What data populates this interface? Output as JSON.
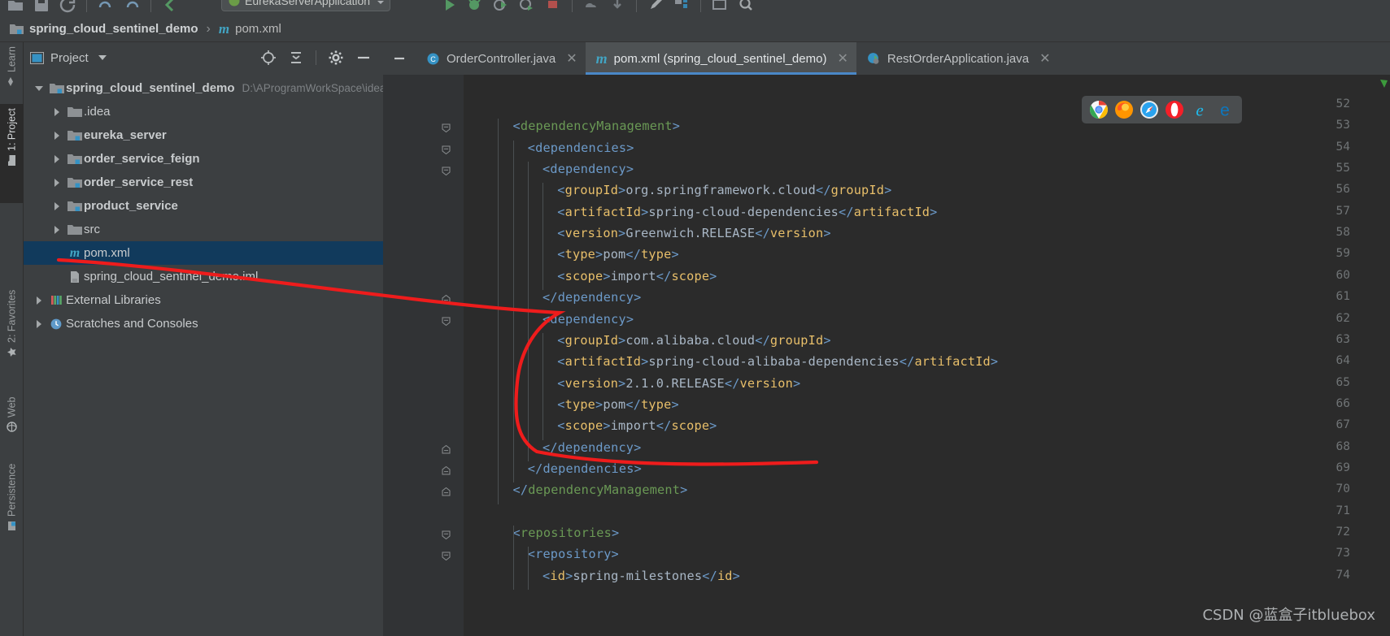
{
  "toolbar": {
    "run_config_label": "EurekaServerApplication",
    "icons": [
      "open-folder-icon",
      "save-icon",
      "sync-icon",
      "undo-icon",
      "redo-icon",
      "back-icon",
      "forward-icon",
      "run-icon",
      "debug-icon",
      "run-coverage-icon",
      "stop-icon",
      "build-icon",
      "update-project-icon",
      "commit-icon",
      "structure-icon",
      "preview-icon",
      "search-icon"
    ]
  },
  "breadcrumb": {
    "project": "spring_cloud_sentinel_demo",
    "separator": "›",
    "file": "pom.xml",
    "file_icon_letter": "m"
  },
  "leftbar": {
    "items": [
      {
        "label": "Learn",
        "icon": "learn-icon",
        "active": false
      },
      {
        "label": "1: Project",
        "icon": "project-folder-icon",
        "active": true
      },
      {
        "label": "2: Favorites",
        "icon": "star-icon",
        "active": false
      },
      {
        "label": "Web",
        "icon": "globe-icon",
        "active": false
      },
      {
        "label": "Persistence",
        "icon": "persistence-icon",
        "active": false
      }
    ]
  },
  "project_panel": {
    "title": "Project",
    "title_icon": "project-view-icon",
    "actions": [
      "locate-icon",
      "collapse-all-icon",
      "settings-gear-icon",
      "hide-minus-icon"
    ],
    "tree": [
      {
        "label": "spring_cloud_sentinel_demo",
        "path": "D:\\AProgramWorkSpace\\idea\\test\\spring_cloud_sentinel_demo",
        "indent": 0,
        "arrow": "open",
        "icon": "module-folder-icon",
        "bold": true,
        "selected": false
      },
      {
        "label": ".idea",
        "path": "",
        "indent": 1,
        "arrow": "closed",
        "icon": "folder-icon",
        "bold": false,
        "selected": false
      },
      {
        "label": "eureka_server",
        "path": "",
        "indent": 1,
        "arrow": "closed",
        "icon": "module-folder-icon",
        "bold": true,
        "selected": false
      },
      {
        "label": "order_service_feign",
        "path": "",
        "indent": 1,
        "arrow": "closed",
        "icon": "module-folder-icon",
        "bold": true,
        "selected": false
      },
      {
        "label": "order_service_rest",
        "path": "",
        "indent": 1,
        "arrow": "closed",
        "icon": "module-folder-icon",
        "bold": true,
        "selected": false
      },
      {
        "label": "product_service",
        "path": "",
        "indent": 1,
        "arrow": "closed",
        "icon": "module-folder-icon",
        "bold": true,
        "selected": false
      },
      {
        "label": "src",
        "path": "",
        "indent": 1,
        "arrow": "closed",
        "icon": "folder-icon",
        "bold": false,
        "selected": false
      },
      {
        "label": "pom.xml",
        "path": "",
        "indent": 1,
        "arrow": "none",
        "icon": "maven-pom-icon",
        "bold": false,
        "selected": true
      },
      {
        "label": "spring_cloud_sentinel_demo.iml",
        "path": "",
        "indent": 1,
        "arrow": "none",
        "icon": "iml-file-icon",
        "bold": false,
        "selected": false
      },
      {
        "label": "External Libraries",
        "path": "",
        "indent": 0,
        "arrow": "closed",
        "icon": "libraries-icon",
        "bold": false,
        "selected": false
      },
      {
        "label": "Scratches and Consoles",
        "path": "",
        "indent": 0,
        "arrow": "closed",
        "icon": "scratches-icon",
        "bold": false,
        "selected": false
      }
    ]
  },
  "editor_tabs": {
    "hide_label": "—",
    "tabs": [
      {
        "label": "OrderController.java",
        "icon": "java-class-icon",
        "active": false,
        "close": "✕"
      },
      {
        "label": "pom.xml (spring_cloud_sentinel_demo)",
        "icon": "maven-pom-icon",
        "active": true,
        "close": "✕"
      },
      {
        "label": "RestOrderApplication.java",
        "icon": "spring-boot-class-icon",
        "active": false,
        "close": "✕"
      }
    ]
  },
  "editor": {
    "first_line": 52,
    "lines": [
      {
        "n": 52,
        "fold": "none",
        "indent": 0,
        "tokens": []
      },
      {
        "n": 53,
        "fold": "open",
        "indent": 2,
        "tokens": [
          {
            "t": "br",
            "v": "<"
          },
          {
            "t": "gtag",
            "v": "dependencyManagement"
          },
          {
            "t": "br",
            "v": ">"
          }
        ]
      },
      {
        "n": 54,
        "fold": "open",
        "indent": 3,
        "tokens": [
          {
            "t": "br",
            "v": "<"
          },
          {
            "t": "br2",
            "v": "dependencies"
          },
          {
            "t": "br",
            "v": ">"
          }
        ]
      },
      {
        "n": 55,
        "fold": "open",
        "indent": 4,
        "tokens": [
          {
            "t": "br",
            "v": "<"
          },
          {
            "t": "br2",
            "v": "dependency"
          },
          {
            "t": "br",
            "v": ">"
          }
        ]
      },
      {
        "n": 56,
        "fold": "none",
        "indent": 5,
        "tokens": [
          {
            "t": "br",
            "v": "<"
          },
          {
            "t": "tg",
            "v": "groupId"
          },
          {
            "t": "br",
            "v": ">"
          },
          {
            "t": "txt",
            "v": "org.springframework.cloud"
          },
          {
            "t": "br",
            "v": "</"
          },
          {
            "t": "tg",
            "v": "groupId"
          },
          {
            "t": "br",
            "v": ">"
          }
        ]
      },
      {
        "n": 57,
        "fold": "none",
        "indent": 5,
        "tokens": [
          {
            "t": "br",
            "v": "<"
          },
          {
            "t": "tg",
            "v": "artifactId"
          },
          {
            "t": "br",
            "v": ">"
          },
          {
            "t": "txt",
            "v": "spring-cloud-dependencies"
          },
          {
            "t": "br",
            "v": "</"
          },
          {
            "t": "tg",
            "v": "artifactId"
          },
          {
            "t": "br",
            "v": ">"
          }
        ]
      },
      {
        "n": 58,
        "fold": "none",
        "indent": 5,
        "tokens": [
          {
            "t": "br",
            "v": "<"
          },
          {
            "t": "tg",
            "v": "version"
          },
          {
            "t": "br",
            "v": ">"
          },
          {
            "t": "txt",
            "v": "Greenwich.RELEASE"
          },
          {
            "t": "br",
            "v": "</"
          },
          {
            "t": "tg",
            "v": "version"
          },
          {
            "t": "br",
            "v": ">"
          }
        ]
      },
      {
        "n": 59,
        "fold": "none",
        "indent": 5,
        "tokens": [
          {
            "t": "br",
            "v": "<"
          },
          {
            "t": "tg",
            "v": "type"
          },
          {
            "t": "br",
            "v": ">"
          },
          {
            "t": "txt",
            "v": "pom"
          },
          {
            "t": "br",
            "v": "</"
          },
          {
            "t": "tg",
            "v": "type"
          },
          {
            "t": "br",
            "v": ">"
          }
        ]
      },
      {
        "n": 60,
        "fold": "none",
        "indent": 5,
        "tokens": [
          {
            "t": "br",
            "v": "<"
          },
          {
            "t": "tg",
            "v": "scope"
          },
          {
            "t": "br",
            "v": ">"
          },
          {
            "t": "txt",
            "v": "import"
          },
          {
            "t": "br",
            "v": "</"
          },
          {
            "t": "tg",
            "v": "scope"
          },
          {
            "t": "br",
            "v": ">"
          }
        ]
      },
      {
        "n": 61,
        "fold": "close",
        "indent": 4,
        "tokens": [
          {
            "t": "br",
            "v": "</"
          },
          {
            "t": "br2",
            "v": "dependency"
          },
          {
            "t": "br",
            "v": ">"
          }
        ]
      },
      {
        "n": 62,
        "fold": "open",
        "indent": 4,
        "tokens": [
          {
            "t": "br",
            "v": "<"
          },
          {
            "t": "br2",
            "v": "dependency"
          },
          {
            "t": "br",
            "v": ">"
          }
        ]
      },
      {
        "n": 63,
        "fold": "none",
        "indent": 5,
        "tokens": [
          {
            "t": "br",
            "v": "<"
          },
          {
            "t": "tg",
            "v": "groupId"
          },
          {
            "t": "br",
            "v": ">"
          },
          {
            "t": "txt",
            "v": "com.alibaba.cloud"
          },
          {
            "t": "br",
            "v": "</"
          },
          {
            "t": "tg",
            "v": "groupId"
          },
          {
            "t": "br",
            "v": ">"
          }
        ]
      },
      {
        "n": 64,
        "fold": "none",
        "indent": 5,
        "tokens": [
          {
            "t": "br",
            "v": "<"
          },
          {
            "t": "tg",
            "v": "artifactId"
          },
          {
            "t": "br",
            "v": ">"
          },
          {
            "t": "txt",
            "v": "spring-cloud-alibaba-dependencies"
          },
          {
            "t": "br",
            "v": "</"
          },
          {
            "t": "tg",
            "v": "artifactId"
          },
          {
            "t": "br",
            "v": ">"
          }
        ]
      },
      {
        "n": 65,
        "fold": "none",
        "indent": 5,
        "tokens": [
          {
            "t": "br",
            "v": "<"
          },
          {
            "t": "tg",
            "v": "version"
          },
          {
            "t": "br",
            "v": ">"
          },
          {
            "t": "txt",
            "v": "2.1.0.RELEASE"
          },
          {
            "t": "br",
            "v": "</"
          },
          {
            "t": "tg",
            "v": "version"
          },
          {
            "t": "br",
            "v": ">"
          }
        ]
      },
      {
        "n": 66,
        "fold": "none",
        "indent": 5,
        "tokens": [
          {
            "t": "br",
            "v": "<"
          },
          {
            "t": "tg",
            "v": "type"
          },
          {
            "t": "br",
            "v": ">"
          },
          {
            "t": "txt",
            "v": "pom"
          },
          {
            "t": "br",
            "v": "</"
          },
          {
            "t": "tg",
            "v": "type"
          },
          {
            "t": "br",
            "v": ">"
          }
        ]
      },
      {
        "n": 67,
        "fold": "none",
        "indent": 5,
        "tokens": [
          {
            "t": "br",
            "v": "<"
          },
          {
            "t": "tg",
            "v": "scope"
          },
          {
            "t": "br",
            "v": ">"
          },
          {
            "t": "txt",
            "v": "import"
          },
          {
            "t": "br",
            "v": "</"
          },
          {
            "t": "tg",
            "v": "scope"
          },
          {
            "t": "br",
            "v": ">"
          }
        ]
      },
      {
        "n": 68,
        "fold": "close",
        "indent": 4,
        "tokens": [
          {
            "t": "br",
            "v": "</"
          },
          {
            "t": "br2",
            "v": "dependency"
          },
          {
            "t": "br",
            "v": ">"
          }
        ]
      },
      {
        "n": 69,
        "fold": "close",
        "indent": 3,
        "tokens": [
          {
            "t": "br",
            "v": "</"
          },
          {
            "t": "br2",
            "v": "dependencies"
          },
          {
            "t": "br",
            "v": ">"
          }
        ]
      },
      {
        "n": 70,
        "fold": "close",
        "indent": 2,
        "tokens": [
          {
            "t": "br",
            "v": "</"
          },
          {
            "t": "gtag",
            "v": "dependencyManagement"
          },
          {
            "t": "br",
            "v": ">"
          }
        ]
      },
      {
        "n": 71,
        "fold": "none",
        "indent": 0,
        "tokens": []
      },
      {
        "n": 72,
        "fold": "open",
        "indent": 2,
        "tokens": [
          {
            "t": "br",
            "v": "<"
          },
          {
            "t": "gtag",
            "v": "repositories"
          },
          {
            "t": "br",
            "v": ">"
          }
        ]
      },
      {
        "n": 73,
        "fold": "open",
        "indent": 3,
        "tokens": [
          {
            "t": "br",
            "v": "<"
          },
          {
            "t": "br2",
            "v": "repository"
          },
          {
            "t": "br",
            "v": ">"
          }
        ]
      },
      {
        "n": 74,
        "fold": "none",
        "indent": 4,
        "tokens": [
          {
            "t": "br",
            "v": "<"
          },
          {
            "t": "tg",
            "v": "id"
          },
          {
            "t": "br",
            "v": ">"
          },
          {
            "t": "txt",
            "v": "spring-milestones"
          },
          {
            "t": "br",
            "v": "</"
          },
          {
            "t": "tg",
            "v": "id"
          },
          {
            "t": "br",
            "v": ">"
          }
        ]
      }
    ]
  },
  "browsers": {
    "items": [
      {
        "name": "chrome-icon",
        "color": "#4285f4"
      },
      {
        "name": "firefox-icon",
        "color": "#ff7139"
      },
      {
        "name": "safari-icon",
        "color": "#1ba8f0"
      },
      {
        "name": "opera-icon",
        "color": "#f41f28"
      },
      {
        "name": "internet-explorer-icon",
        "color": "#1ebbee"
      },
      {
        "name": "edge-icon",
        "color": "#0c77bf"
      }
    ]
  },
  "watermark": {
    "text": "CSDN @蓝盒子itbluebox"
  },
  "colors": {
    "background": "#3c3f41",
    "editor_background": "#2b2b2b",
    "gutter": "#313335",
    "selection": "#113a5c",
    "tab_active": "#4e5254",
    "tab_underline": "#4a88c7",
    "xml_tag": "#e8bf6a",
    "xml_bracket": "#6c9ac9",
    "xml_text": "#a9b7c6",
    "xml_root_tag": "#6a9955",
    "annotation_red": "#ee1c1c"
  }
}
